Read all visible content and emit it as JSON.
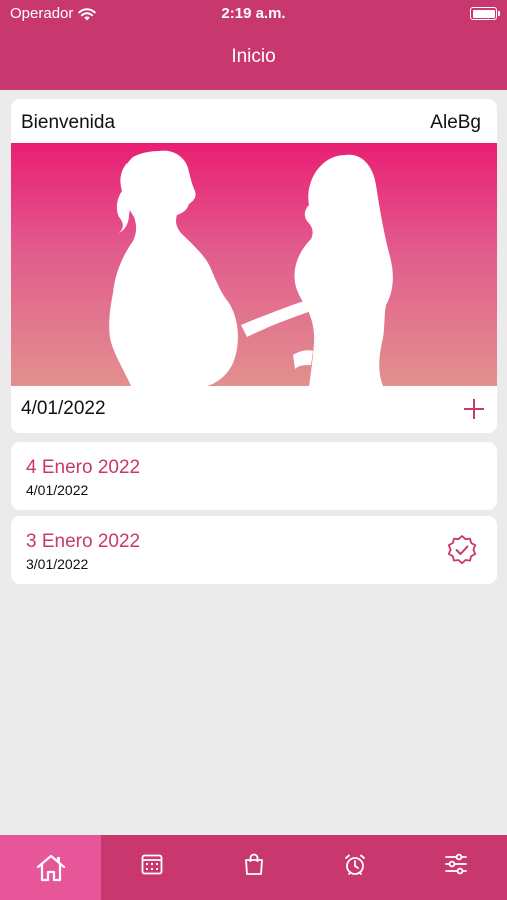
{
  "status_bar": {
    "carrier": "Operador",
    "time": "2:19 a.m."
  },
  "nav": {
    "title": "Inicio"
  },
  "welcome_card": {
    "greeting": "Bienvenida",
    "username": "AleBg",
    "date": "4/01/2022",
    "add_icon": "plus-icon"
  },
  "entries": [
    {
      "title": "4 Enero 2022",
      "date": "4/01/2022",
      "completed": false
    },
    {
      "title": "3 Enero 2022",
      "date": "3/01/2022",
      "completed": true,
      "icon": "verified-badge-icon"
    }
  ],
  "tabbar": {
    "items": [
      {
        "icon": "home-icon",
        "active": true
      },
      {
        "icon": "calendar-icon",
        "active": false
      },
      {
        "icon": "bag-icon",
        "active": false
      },
      {
        "icon": "alarm-clock-icon",
        "active": false
      },
      {
        "icon": "sliders-icon",
        "active": false
      }
    ]
  },
  "colors": {
    "brand": "#c8386f",
    "tab_active": "#e8569a",
    "background": "#ebebeb"
  }
}
